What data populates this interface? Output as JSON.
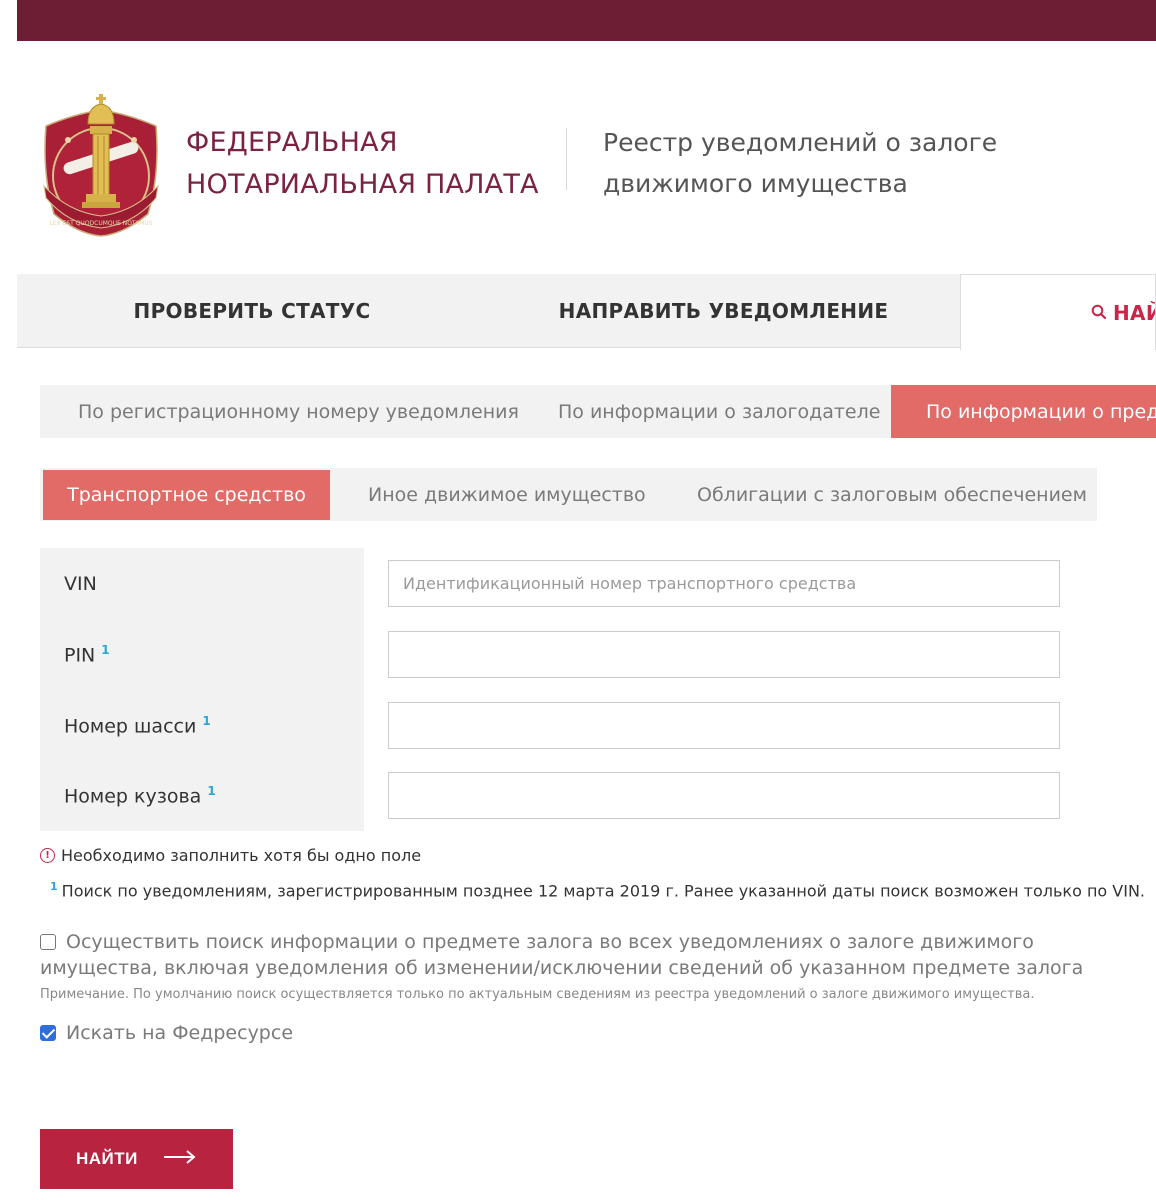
{
  "header": {
    "org_name_line1": "ФЕДЕРАЛЬНАЯ",
    "org_name_line2": "НОТАРИАЛЬНАЯ ПАЛАТА",
    "registry_line1": "Реестр уведомлений о залоге",
    "registry_line2": "движимого имущества",
    "emblem_motto": "LEX EST QUODCUMQUE NOTAMUS",
    "emblem_icon": "notary-emblem-icon"
  },
  "main_tabs": [
    {
      "label": "ПРОВЕРИТЬ СТАТУС"
    },
    {
      "label": "НАПРАВИТЬ УВЕДОМЛЕНИЕ"
    },
    {
      "label": "НАЙТИ В РЕЕСТРЕ",
      "active": true,
      "icon": "search-icon"
    }
  ],
  "sub_tabs": [
    {
      "label": "По регистрационному номеру уведомления"
    },
    {
      "label": "По информации о залогодателе"
    },
    {
      "label": "По информации о предмете залога",
      "active": true
    }
  ],
  "category_tabs": [
    {
      "label": "Транспортное средство",
      "active": true
    },
    {
      "label": "Иное движимое имущество"
    },
    {
      "label": "Облигации с залоговым обеспечением"
    }
  ],
  "form": {
    "fields": [
      {
        "label": "VIN",
        "footnote": "",
        "value": "",
        "placeholder": "Идентификационный номер транспортного средства"
      },
      {
        "label": "PIN",
        "footnote": "1",
        "value": "",
        "placeholder": ""
      },
      {
        "label": "Номер шасси",
        "footnote": "1",
        "value": "",
        "placeholder": ""
      },
      {
        "label": "Номер кузова",
        "footnote": "1",
        "value": "",
        "placeholder": ""
      }
    ],
    "required_notice": "Необходимо заполнить хотя бы одно поле",
    "footnote_mark": "1",
    "footnote_text": "Поиск по уведомлениям, зарегистрированным позднее 12 марта 2019 г. Ранее указанной даты поиск возможен только по VIN.",
    "all_notices_checkbox": {
      "label": "Осуществить поиск информации о предмете залога во всех уведомлениях о залоге движимого имущества, включая уведомления об изменении/исключении сведений об указанном предмете залога",
      "checked": false
    },
    "note": "Примечание. По умолчанию поиск осуществляется только по актуальным сведениям из реестра уведомлений о залоге движимого имущества.",
    "fedresurs_checkbox": {
      "label": "Искать на Федресурсе",
      "checked": true
    },
    "submit_label": "НАЙТИ",
    "submit_icon": "arrow-right-icon"
  },
  "colors": {
    "topbar": "#6e1e34",
    "brand": "#7b2240",
    "accent_tab": "#e26b67",
    "button": "#b8233f",
    "footnote": "#2aa7d9",
    "checkbox_checked": "#2f6fdc"
  }
}
